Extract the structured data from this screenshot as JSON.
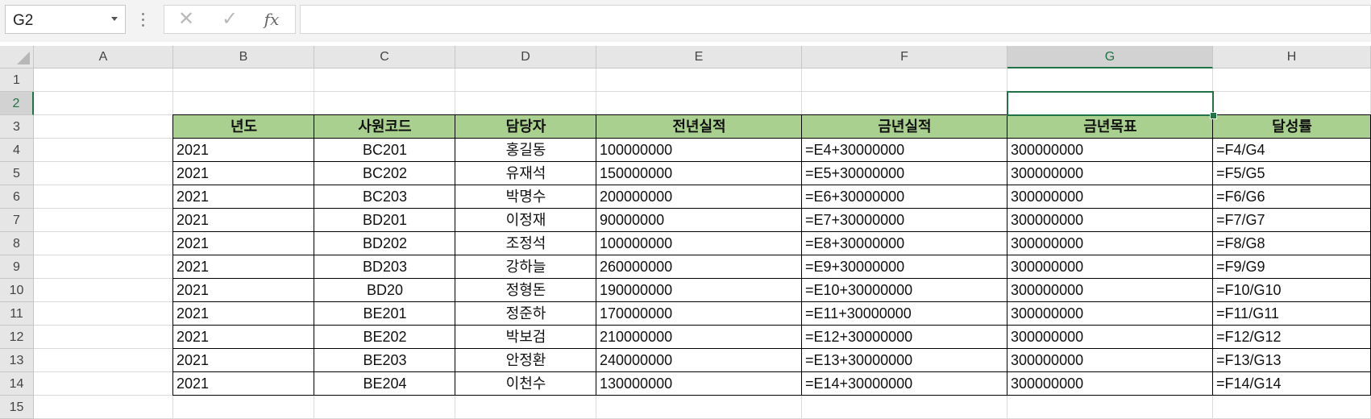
{
  "formula_bar": {
    "name_box": "G2",
    "cancel_icon": "✕",
    "enter_icon": "✓",
    "fx_icon": "fx",
    "formula": ""
  },
  "columns": [
    "A",
    "B",
    "C",
    "D",
    "E",
    "F",
    "G",
    "H"
  ],
  "selected_column": "G",
  "rows": [
    "1",
    "2",
    "3",
    "4",
    "5",
    "6",
    "7",
    "8",
    "9",
    "10",
    "11",
    "12",
    "13",
    "14",
    "15"
  ],
  "selected_row": "2",
  "table": {
    "headers": [
      "년도",
      "사원코드",
      "담당자",
      "전년실적",
      "금년실적",
      "금년목표",
      "달성률"
    ],
    "rows": [
      [
        "2021",
        "BC201",
        "홍길동",
        "100000000",
        "=E4+30000000",
        "300000000",
        "=F4/G4"
      ],
      [
        "2021",
        "BC202",
        "유재석",
        "150000000",
        "=E5+30000000",
        "300000000",
        "=F5/G5"
      ],
      [
        "2021",
        "BC203",
        "박명수",
        "200000000",
        "=E6+30000000",
        "300000000",
        "=F6/G6"
      ],
      [
        "2021",
        "BD201",
        "이정재",
        "90000000",
        "=E7+30000000",
        "300000000",
        "=F7/G7"
      ],
      [
        "2021",
        "BD202",
        "조정석",
        "100000000",
        "=E8+30000000",
        "300000000",
        "=F8/G8"
      ],
      [
        "2021",
        "BD203",
        "강하늘",
        "260000000",
        "=E9+30000000",
        "300000000",
        "=F9/G9"
      ],
      [
        "2021",
        "BD20",
        "정형돈",
        "190000000",
        "=E10+30000000",
        "300000000",
        "=F10/G10"
      ],
      [
        "2021",
        "BE201",
        "정준하",
        "170000000",
        "=E11+30000000",
        "300000000",
        "=F11/G11"
      ],
      [
        "2021",
        "BE202",
        "박보검",
        "210000000",
        "=E12+30000000",
        "300000000",
        "=F12/G12"
      ],
      [
        "2021",
        "BE203",
        "안정환",
        "240000000",
        "=E13+30000000",
        "300000000",
        "=F13/G13"
      ],
      [
        "2021",
        "BE204",
        "이천수",
        "130000000",
        "=E14+30000000",
        "300000000",
        "=F14/G14"
      ]
    ]
  },
  "colors": {
    "header_fill": "#a9d08e",
    "selection": "#217346"
  }
}
